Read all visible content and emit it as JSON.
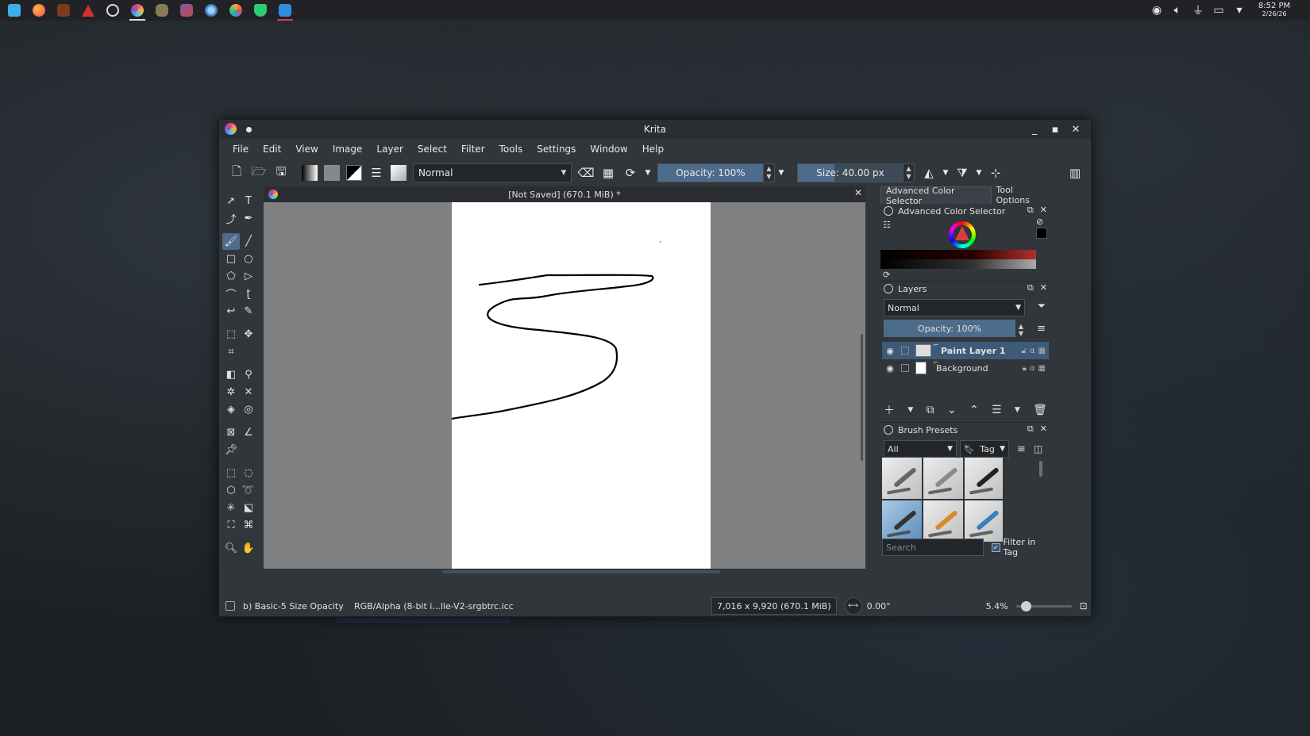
{
  "taskbar": {
    "apps": [
      {
        "name": "app-launcher",
        "color": "#3daee9"
      },
      {
        "name": "firefox",
        "color": "#ff7139"
      },
      {
        "name": "app-brown",
        "color": "#7a3b1d"
      },
      {
        "name": "app-red",
        "color": "#d62f2f"
      },
      {
        "name": "app-steam",
        "color": "#dddddd"
      },
      {
        "name": "krita",
        "color": "#e83e8c"
      },
      {
        "name": "app-gimp",
        "color": "#8a7a5a"
      },
      {
        "name": "app-purple",
        "color": "#7b5aa6"
      },
      {
        "name": "app-blue-circle",
        "color": "#3a7fc1"
      },
      {
        "name": "app-color-wheel",
        "color": "#f2a93b"
      },
      {
        "name": "app-green",
        "color": "#2ecc71"
      },
      {
        "name": "app-terminal",
        "color": "#2f8fdf"
      }
    ],
    "clock_time": "8:52 PM",
    "clock_date": "2/26/26"
  },
  "window": {
    "title": "Krita",
    "menu": [
      "File",
      "Edit",
      "View",
      "Image",
      "Layer",
      "Select",
      "Filter",
      "Tools",
      "Settings",
      "Window",
      "Help"
    ],
    "toolbar": {
      "blend_mode": "Normal",
      "opacity_label": "Opacity: 100%",
      "opacity_value": 1.0,
      "size_label": "Size: 40.00 px",
      "size_fraction": 0.35
    },
    "document": {
      "title": "[Not Saved]  (670.1 MiB) *"
    },
    "dock": {
      "tabs": [
        "Advanced Color Selector",
        "Tool Options"
      ],
      "color_selector_title": "Advanced Color Selector",
      "layers_title": "Layers",
      "layers_blend": "Normal",
      "layers_opacity": "Opacity:  100%",
      "layers": [
        {
          "name": "Paint Layer 1",
          "selected": true
        },
        {
          "name": "Background",
          "selected": false
        }
      ],
      "brush_presets_title": "Brush Presets",
      "brush_filter": "All",
      "brush_tag": "Tag",
      "search_placeholder": "Search",
      "filter_in_tag": "Filter in Tag"
    },
    "status": {
      "brush": "b) Basic-5 Size Opacity",
      "colorspace": "RGB/Alpha (8-bit i...lle-V2-srgbtrc.icc",
      "image_size": "7,016 x 9,920 (670.1 MiB)",
      "rotation": "0.00°",
      "zoom": "5.4%"
    }
  }
}
